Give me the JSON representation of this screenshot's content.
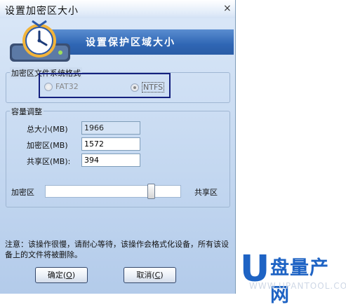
{
  "window": {
    "title": "设置加密区大小",
    "close_glyph": "×"
  },
  "banner": {
    "title": "设置保护区域大小",
    "icon": "clock-drive-icon"
  },
  "fs_group": {
    "legend": "加密区文件系统格式",
    "options": [
      "FAT32",
      "NTFS"
    ],
    "selected": "NTFS"
  },
  "capacity": {
    "legend": "容量调整",
    "total_label": "总大小(MB)",
    "total_value": "1966",
    "encrypted_label": "加密区(MB)",
    "encrypted_value": "1572",
    "shared_label": "共享区(MB):",
    "shared_value": "394",
    "slider_left": "加密区",
    "slider_right": "共享区",
    "slider_fraction": 0.8
  },
  "note": "注意：该操作很慢，请耐心等待，该操作会格式化设备，所有该设备上的文件将被删除。",
  "buttons": {
    "ok_prefix": "确定(",
    "ok_key": "O",
    "ok_suffix": ")",
    "cancel_prefix": "取消(",
    "cancel_key": "C",
    "cancel_suffix": ")"
  },
  "watermark": {
    "u": "U",
    "cn": "盘量产网",
    "en": "WWW.UPANTOOL.COM"
  },
  "colors": {
    "accent": "#2f66b4",
    "highlight_border": "#14207e",
    "watermark": "#1e63c4"
  }
}
